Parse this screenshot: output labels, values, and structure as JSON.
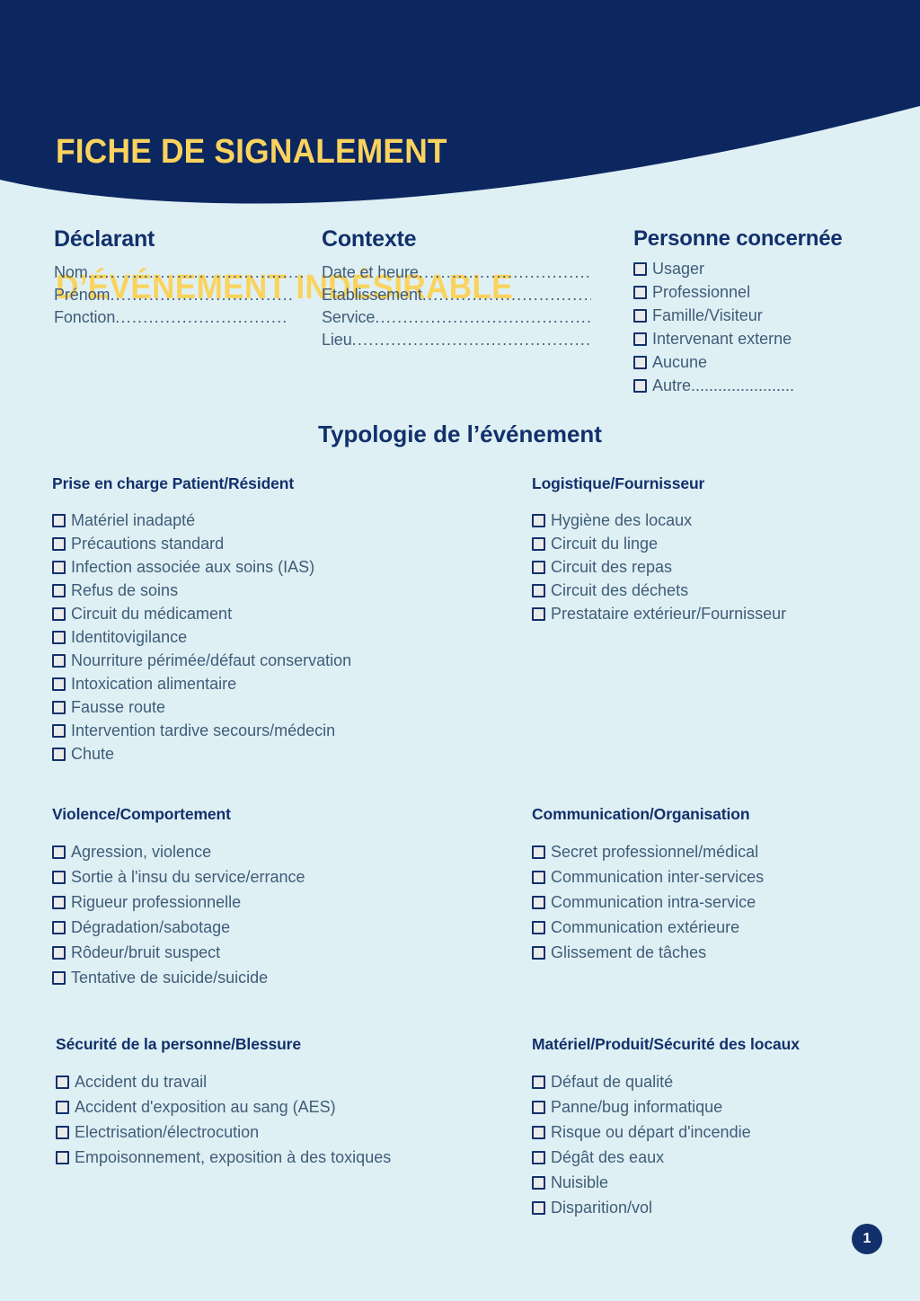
{
  "document": {
    "title_lines": [
      "FICHE DE SIGNALEMENT",
      "D’ÉVÉNEMENT INDÉSIRABLE"
    ],
    "page_number": "1",
    "colors": {
      "header_navy": "#0c2760",
      "title_yellow": "#fad35e",
      "page_background": "#dff0f4",
      "heading_navy": "#12306b",
      "body_text": "#3f5c79",
      "checkbox_fill": "#e9eaea"
    }
  },
  "declarant": {
    "heading": "Déclarant",
    "fields": [
      {
        "label": "Nom",
        "dots": "........................................"
      },
      {
        "label": "Prénom",
        "dots": "................................."
      },
      {
        "label": "Fonction",
        "dots": "..............................."
      }
    ]
  },
  "contexte": {
    "heading": "Contexte",
    "fields": [
      {
        "label": "Date et heure",
        "dots": "................................"
      },
      {
        "label": "Etablissement",
        "dots": "................................"
      },
      {
        "label": "Service",
        "dots": "............................................."
      },
      {
        "label": "Lieu",
        "dots": "................................................."
      }
    ]
  },
  "personne_concernee": {
    "heading": "Personne concernée",
    "options": [
      {
        "label": "Usager"
      },
      {
        "label": "Professionnel"
      },
      {
        "label": "Famille/Visiteur"
      },
      {
        "label": "Intervenant externe"
      },
      {
        "label": "Aucune"
      },
      {
        "label": "Autre......................."
      }
    ]
  },
  "typologie": {
    "title": "Typologie de l’événement",
    "categories": [
      {
        "id": "prise_en_charge",
        "heading": "Prise en charge Patient/Résident",
        "options": [
          "Matériel inadapté",
          "Précautions standard",
          "Infection associée aux soins (IAS)",
          "Refus de soins",
          "Circuit du médicament",
          "Identitovigilance",
          "Nourriture périmée/défaut conservation",
          "Intoxication alimentaire",
          "Fausse route",
          "Intervention tardive secours/médecin",
          "Chute"
        ]
      },
      {
        "id": "logistique_fournisseur",
        "heading": "Logistique/Fournisseur",
        "options": [
          "Hygiène des locaux",
          "Circuit du linge",
          "Circuit des repas",
          "Circuit des déchets",
          "Prestataire extérieur/Fournisseur"
        ]
      },
      {
        "id": "violence_comportement",
        "heading": "Violence/Comportement",
        "options": [
          "Agression, violence",
          "Sortie à l'insu du service/errance",
          "Rigueur professionnelle",
          "Dégradation/sabotage",
          "Rôdeur/bruit suspect",
          "Tentative de suicide/suicide"
        ]
      },
      {
        "id": "communication_organisation",
        "heading": "Communication/Organisation",
        "options": [
          "Secret professionnel/médical",
          "Communication inter-services",
          "Communication intra-service",
          "Communication extérieure",
          "Glissement de tâches"
        ]
      },
      {
        "id": "securite_personne_blessure",
        "heading": "Sécurité de la personne/Blessure",
        "options": [
          "Accident du travail",
          "Accident d'exposition au sang (AES)",
          "Electrisation/électrocution",
          "Empoisonnement, exposition à des toxiques"
        ]
      },
      {
        "id": "materiel_produit_securite_locaux",
        "heading": "Matériel/Produit/Sécurité des locaux",
        "options": [
          "Défaut de qualité",
          "Panne/bug informatique",
          "Risque ou départ d'incendie",
          "Dégât des eaux",
          "Nuisible",
          "Disparition/vol"
        ]
      }
    ]
  }
}
